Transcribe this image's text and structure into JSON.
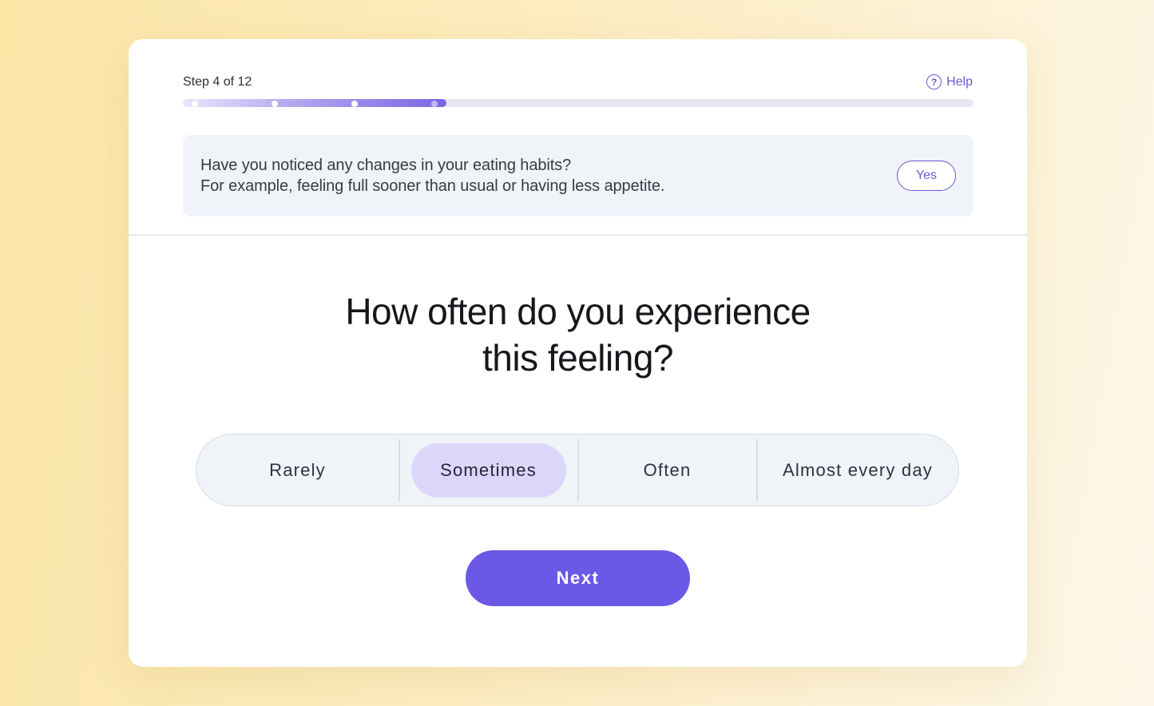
{
  "progress": {
    "step_label": "Step 4 of 12",
    "current_step": 4,
    "total_steps": 12,
    "fill_fraction": 0.333
  },
  "help": {
    "label": "Help",
    "icon": "question-circle-icon"
  },
  "info": {
    "line1": "Have you noticed any changes in your eating habits?",
    "line2": "For example, feeling full sooner than usual or having less appetite.",
    "answer_label": "Yes"
  },
  "question": {
    "line1": "How often do you experience",
    "line2": "this feeling?"
  },
  "options": [
    {
      "label": "Rarely",
      "selected": false
    },
    {
      "label": "Sometimes",
      "selected": true
    },
    {
      "label": "Often",
      "selected": false
    },
    {
      "label": "Almost every day",
      "selected": false
    }
  ],
  "next_label": "Next",
  "colors": {
    "accent": "#6b58e6",
    "selected_option": "#dcd6fb",
    "info_background": "#f0f3f8"
  }
}
